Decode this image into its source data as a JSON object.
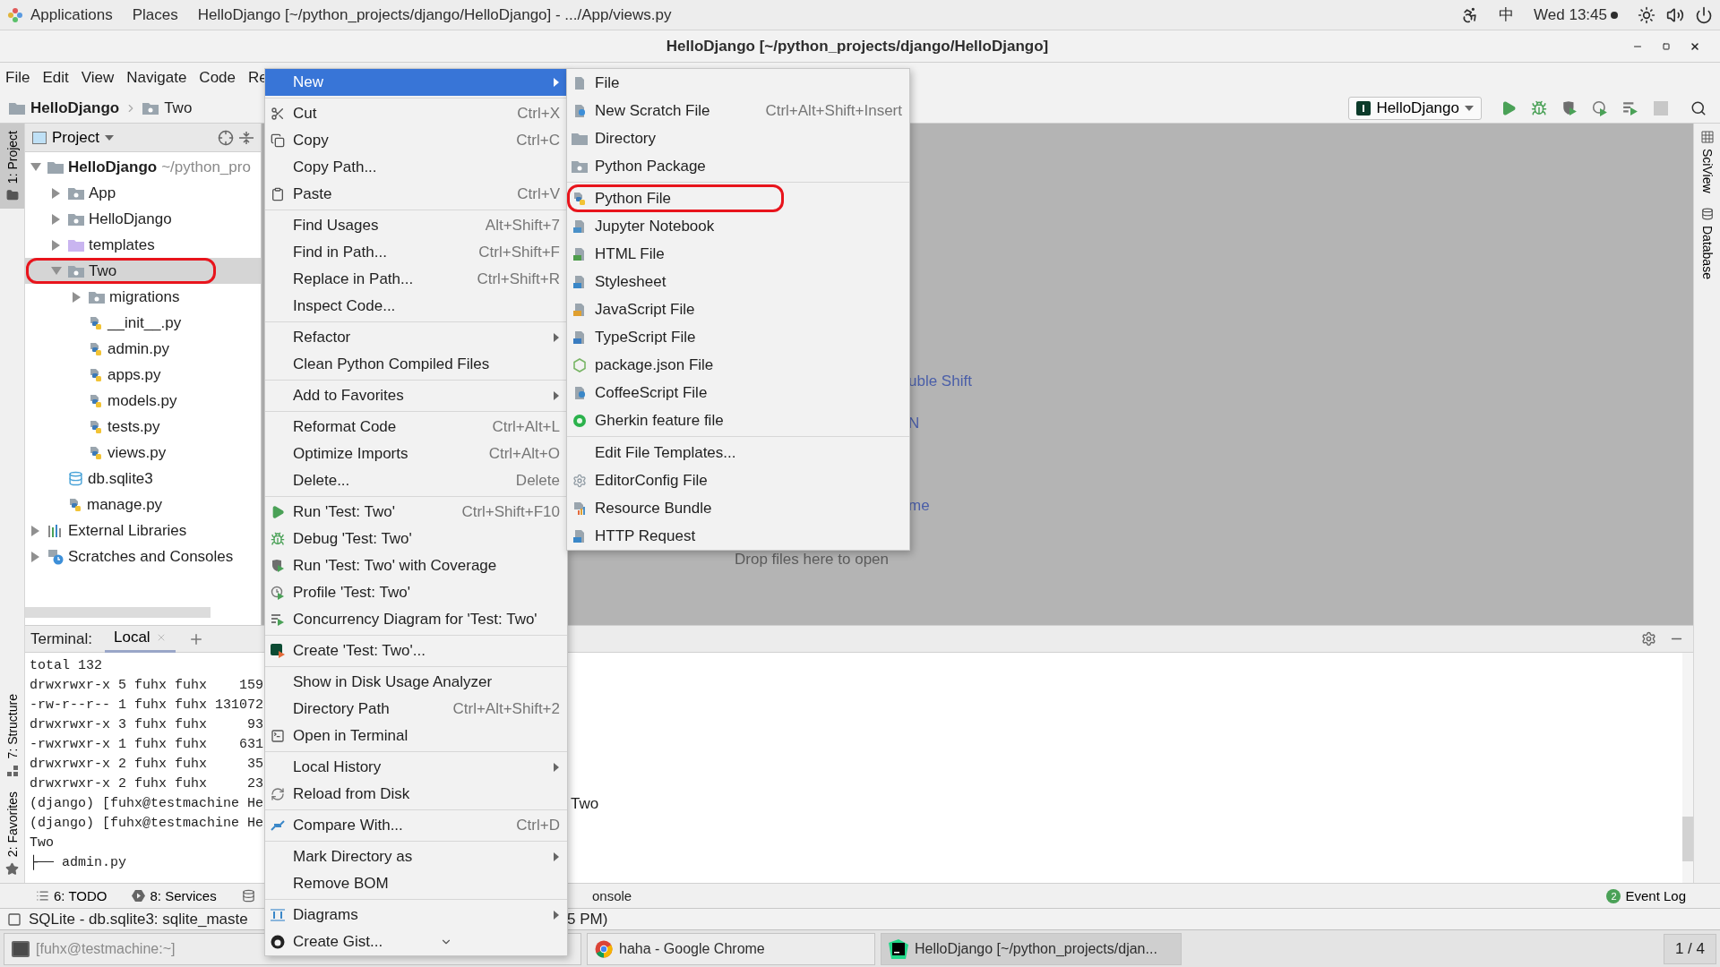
{
  "top_bar": {
    "applications": "Applications",
    "places": "Places",
    "window_title": "HelloDjango [~/python_projects/django/HelloDjango] - .../App/views.py",
    "input_method": "中",
    "clock": "Wed 13:45"
  },
  "window": {
    "title": "HelloDjango [~/python_projects/django/HelloDjango]"
  },
  "menu_bar": [
    "File",
    "Edit",
    "View",
    "Navigate",
    "Code",
    "Re"
  ],
  "breadcrumb": [
    "HelloDjango",
    "Two"
  ],
  "run_config": {
    "label": "HelloDjango"
  },
  "left_stripe": [
    {
      "label": "1: Project",
      "selected": true
    },
    {
      "label": "7: Structure",
      "selected": false
    },
    {
      "label": "2: Favorites",
      "selected": false
    }
  ],
  "right_stripe": [
    "SciView",
    "Database"
  ],
  "project_panel": {
    "title": "Project",
    "tree": [
      {
        "label": "HelloDjango",
        "hint": "~/python_pro",
        "kind": "project",
        "expanded": true,
        "selected": false,
        "annotated": false,
        "children": [
          {
            "label": "App",
            "kind": "folder",
            "expanded": false,
            "selected": false,
            "annotated": false
          },
          {
            "label": "HelloDjango",
            "kind": "folder",
            "expanded": false,
            "selected": false,
            "annotated": false
          },
          {
            "label": "templates",
            "kind": "templates",
            "expanded": false,
            "selected": false,
            "annotated": false
          },
          {
            "label": "Two",
            "kind": "folder",
            "expanded": true,
            "selected": true,
            "annotated": true,
            "children": [
              {
                "label": "migrations",
                "kind": "folder",
                "expanded": false,
                "selected": false,
                "annotated": false
              },
              {
                "label": "__init__.py",
                "kind": "python",
                "selected": false,
                "annotated": false
              },
              {
                "label": "admin.py",
                "kind": "python",
                "selected": false,
                "annotated": false
              },
              {
                "label": "apps.py",
                "kind": "python",
                "selected": false,
                "annotated": false
              },
              {
                "label": "models.py",
                "kind": "python",
                "selected": false,
                "annotated": false
              },
              {
                "label": "tests.py",
                "kind": "python",
                "selected": false,
                "annotated": false
              },
              {
                "label": "views.py",
                "kind": "python",
                "selected": false,
                "annotated": false
              }
            ]
          },
          {
            "label": "db.sqlite3",
            "kind": "db",
            "selected": false,
            "annotated": false
          },
          {
            "label": "manage.py",
            "kind": "python",
            "selected": false,
            "annotated": false
          }
        ]
      },
      {
        "label": "External Libraries",
        "kind": "libraries",
        "expanded": false,
        "selected": false,
        "annotated": false
      },
      {
        "label": "Scratches and Consoles",
        "kind": "scratches",
        "expanded": false,
        "selected": false,
        "annotated": false
      }
    ]
  },
  "editor": {
    "hints": [
      "uble Shift",
      "N",
      "me"
    ],
    "drop_text": "Drop files here to open"
  },
  "terminal": {
    "title": "Terminal:",
    "tabs": [
      {
        "label": "Local",
        "selected": true
      }
    ],
    "lines": [
      {
        "text": "total 132"
      },
      {
        "text": "drwxrwxr-x 5 fuhx fuhx    159"
      },
      {
        "text": "-rw-r--r-- 1 fuhx fuhx 131072"
      },
      {
        "text": "drwxrwxr-x 3 fuhx fuhx     93"
      },
      {
        "text": "-rwxrwxr-x 1 fuhx fuhx    631"
      },
      {
        "text": "drwxrwxr-x 2 fuhx fuhx     35"
      },
      {
        "text": "drwxrwxr-x 2 fuhx fuhx     23"
      },
      {
        "text": "(django) [fuhx@testmachine He",
        "tail": "Two"
      },
      {
        "text": "(django) [fuhx@testmachine He"
      },
      {
        "text": "Two"
      },
      {
        "text": "├── admin.py"
      }
    ]
  },
  "tool_windows": [
    "6: TODO",
    "8: Services"
  ],
  "tool_fragment": "onsole",
  "event_log": {
    "label": "Event Log",
    "count": "2"
  },
  "status_bar": {
    "left": "SQLite - db.sqlite3: sqlite_maste",
    "right": "5 PM)"
  },
  "taskbar": {
    "items": [
      {
        "label": "[fuhx@testmachine:~]",
        "selected": false
      },
      {
        "label": "haha - Google Chrome",
        "selected": false
      },
      {
        "label": "HelloDjango [~/python_projects/djan...",
        "selected": true
      }
    ],
    "workspace": "1 / 4"
  },
  "context_menu": {
    "sections": [
      {
        "items": [
          {
            "label": "New",
            "kind": "plain",
            "submenu": true,
            "selected": true
          }
        ]
      },
      {
        "items": [
          {
            "label": "Cut",
            "kind": "scissors",
            "shortcut": "Ctrl+X",
            "submenu": false,
            "selected": false
          },
          {
            "label": "Copy",
            "kind": "copy",
            "shortcut": "Ctrl+C",
            "submenu": false,
            "selected": false
          },
          {
            "label": "Copy Path...",
            "kind": "plain",
            "submenu": false,
            "selected": false
          },
          {
            "label": "Paste",
            "kind": "paste",
            "shortcut": "Ctrl+V",
            "submenu": false,
            "selected": false
          }
        ]
      },
      {
        "items": [
          {
            "label": "Find Usages",
            "kind": "plain",
            "shortcut": "Alt+Shift+7",
            "submenu": false,
            "selected": false
          },
          {
            "label": "Find in Path...",
            "kind": "plain",
            "shortcut": "Ctrl+Shift+F",
            "submenu": false,
            "selected": false
          },
          {
            "label": "Replace in Path...",
            "kind": "plain",
            "shortcut": "Ctrl+Shift+R",
            "submenu": false,
            "selected": false
          },
          {
            "label": "Inspect Code...",
            "kind": "plain",
            "submenu": false,
            "selected": false
          }
        ]
      },
      {
        "items": [
          {
            "label": "Refactor",
            "kind": "plain",
            "submenu": true,
            "selected": false
          },
          {
            "label": "Clean Python Compiled Files",
            "kind": "plain",
            "submenu": false,
            "selected": false
          }
        ]
      },
      {
        "items": [
          {
            "label": "Add to Favorites",
            "kind": "plain",
            "submenu": true,
            "selected": false
          }
        ]
      },
      {
        "items": [
          {
            "label": "Reformat Code",
            "kind": "plain",
            "shortcut": "Ctrl+Alt+L",
            "submenu": false,
            "selected": false
          },
          {
            "label": "Optimize Imports",
            "kind": "plain",
            "shortcut": "Ctrl+Alt+O",
            "submenu": false,
            "selected": false
          },
          {
            "label": "Delete...",
            "kind": "plain",
            "shortcut": "Delete",
            "submenu": false,
            "selected": false
          }
        ]
      },
      {
        "items": [
          {
            "label": "Run 'Test: Two'",
            "kind": "run",
            "shortcut": "Ctrl+Shift+F10",
            "submenu": false,
            "selected": false
          },
          {
            "label": "Debug 'Test: Two'",
            "kind": "debug",
            "submenu": false,
            "selected": false
          },
          {
            "label": "Run 'Test: Two' with Coverage",
            "kind": "coverage",
            "submenu": false,
            "selected": false
          },
          {
            "label": "Profile 'Test: Two'",
            "kind": "profile",
            "submenu": false,
            "selected": false
          },
          {
            "label": "Concurrency Diagram for 'Test: Two'",
            "kind": "concurrency",
            "submenu": false,
            "selected": false
          }
        ]
      },
      {
        "items": [
          {
            "label": "Create 'Test: Two'...",
            "kind": "django",
            "submenu": false,
            "selected": false
          }
        ]
      },
      {
        "items": [
          {
            "label": "Show in Disk Usage Analyzer",
            "kind": "plain",
            "submenu": false,
            "selected": false
          },
          {
            "label": "Directory Path",
            "kind": "plain",
            "shortcut": "Ctrl+Alt+Shift+2",
            "submenu": false,
            "selected": false
          },
          {
            "label": "Open in Terminal",
            "kind": "terminal",
            "submenu": false,
            "selected": false
          }
        ]
      },
      {
        "items": [
          {
            "label": "Local History",
            "kind": "plain",
            "submenu": true,
            "selected": false
          },
          {
            "label": "Reload from Disk",
            "kind": "reload",
            "submenu": false,
            "selected": false
          }
        ]
      },
      {
        "items": [
          {
            "label": "Compare With...",
            "kind": "compare",
            "shortcut": "Ctrl+D",
            "submenu": false,
            "selected": false
          }
        ]
      },
      {
        "items": [
          {
            "label": "Mark Directory as",
            "kind": "plain",
            "submenu": true,
            "selected": false
          },
          {
            "label": "Remove BOM",
            "kind": "plain",
            "submenu": false,
            "selected": false
          }
        ]
      },
      {
        "items": [
          {
            "label": "Diagrams",
            "kind": "diagrams",
            "submenu": true,
            "selected": false
          },
          {
            "label": "Create Gist...",
            "kind": "gist",
            "submenu": false,
            "selected": false
          }
        ]
      }
    ]
  },
  "new_submenu": {
    "sections": [
      {
        "items": [
          {
            "label": "File",
            "kind": "file",
            "annotated": false
          },
          {
            "label": "New Scratch File",
            "kind": "scratch",
            "shortcut": "Ctrl+Alt+Shift+Insert",
            "annotated": false
          },
          {
            "label": "Directory",
            "kind": "folder",
            "annotated": false
          },
          {
            "label": "Python Package",
            "kind": "package",
            "annotated": false
          }
        ]
      },
      {
        "items": [
          {
            "label": "Python File",
            "kind": "python",
            "annotated": true
          },
          {
            "label": "Jupyter Notebook",
            "kind": "jupyter",
            "annotated": false
          },
          {
            "label": "HTML File",
            "kind": "html",
            "annotated": false
          },
          {
            "label": "Stylesheet",
            "kind": "css",
            "annotated": false
          },
          {
            "label": "JavaScript File",
            "kind": "js",
            "annotated": false
          },
          {
            "label": "TypeScript File",
            "kind": "ts",
            "annotated": false
          },
          {
            "label": "package.json File",
            "kind": "npm",
            "annotated": false
          },
          {
            "label": "CoffeeScript File",
            "kind": "coffee",
            "annotated": false
          },
          {
            "label": "Gherkin feature file",
            "kind": "gherkin",
            "annotated": false
          }
        ]
      },
      {
        "items": [
          {
            "label": "Edit File Templates...",
            "kind": "plain",
            "annotated": false
          },
          {
            "label": "EditorConfig File",
            "kind": "editorconfig",
            "annotated": false
          },
          {
            "label": "Resource Bundle",
            "kind": "resource",
            "annotated": false
          },
          {
            "label": "HTTP Request",
            "kind": "http",
            "annotated": false
          }
        ]
      }
    ]
  }
}
